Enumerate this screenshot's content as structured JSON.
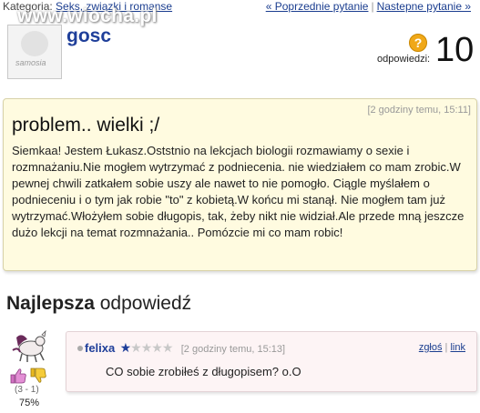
{
  "topbar": {
    "category_label": "Kategoria:",
    "category_link": "Seks, związki i romanse",
    "prev_link": "« Poprzednie pytanie",
    "next_link": "Nastepne pytanie »",
    "separator": "|"
  },
  "watermark": "www.wiocha.pl",
  "asker": {
    "name": "gosc",
    "avatar_logo": "samosia"
  },
  "answers": {
    "label": "odpowiedzi:",
    "count": "10",
    "icon": "question-icon",
    "icon_color": "#f0a818"
  },
  "question": {
    "time": "[2 godziny temu, 15:11]",
    "title": "problem.. wielki ;/",
    "body": "Siemkaa! Jestem Łukasz.Oststnio na lekcjach biologii rozmawiamy o sexie i rozmnażaniu.Nie mogłem wytrzymać z podniecenia. nie wiedziałem co mam zrobic.W pewnej chwili zatkałem sobie uszy ale nawet to nie pomogło. Ciągle myślałem o podnieceniu i o tym jak robie \"to\" z kobietą.W końcu mi stanął. Nie mogłem tam już wytrzymać.Włożyłem sobie długopis, tak, żeby nikt nie widział.Ale przede mną jeszcze dużo lekcji na temat rozmnażania.. Pomózcie mi co mam robic!"
  },
  "best": {
    "heading_bold": "Najlepsza",
    "heading_rest": " odpowiedź"
  },
  "answer": {
    "name": "felixa",
    "stars_filled": 1,
    "stars_total": 5,
    "time": "[2 godziny temu, 15:13]",
    "report_link": "zgłoś",
    "link_link": "link",
    "text": "CO sobie zrobiłeś z długopisem? o.O",
    "votes": "(3 - 1)",
    "percent": "75%",
    "accent": "#1f3f9a"
  }
}
